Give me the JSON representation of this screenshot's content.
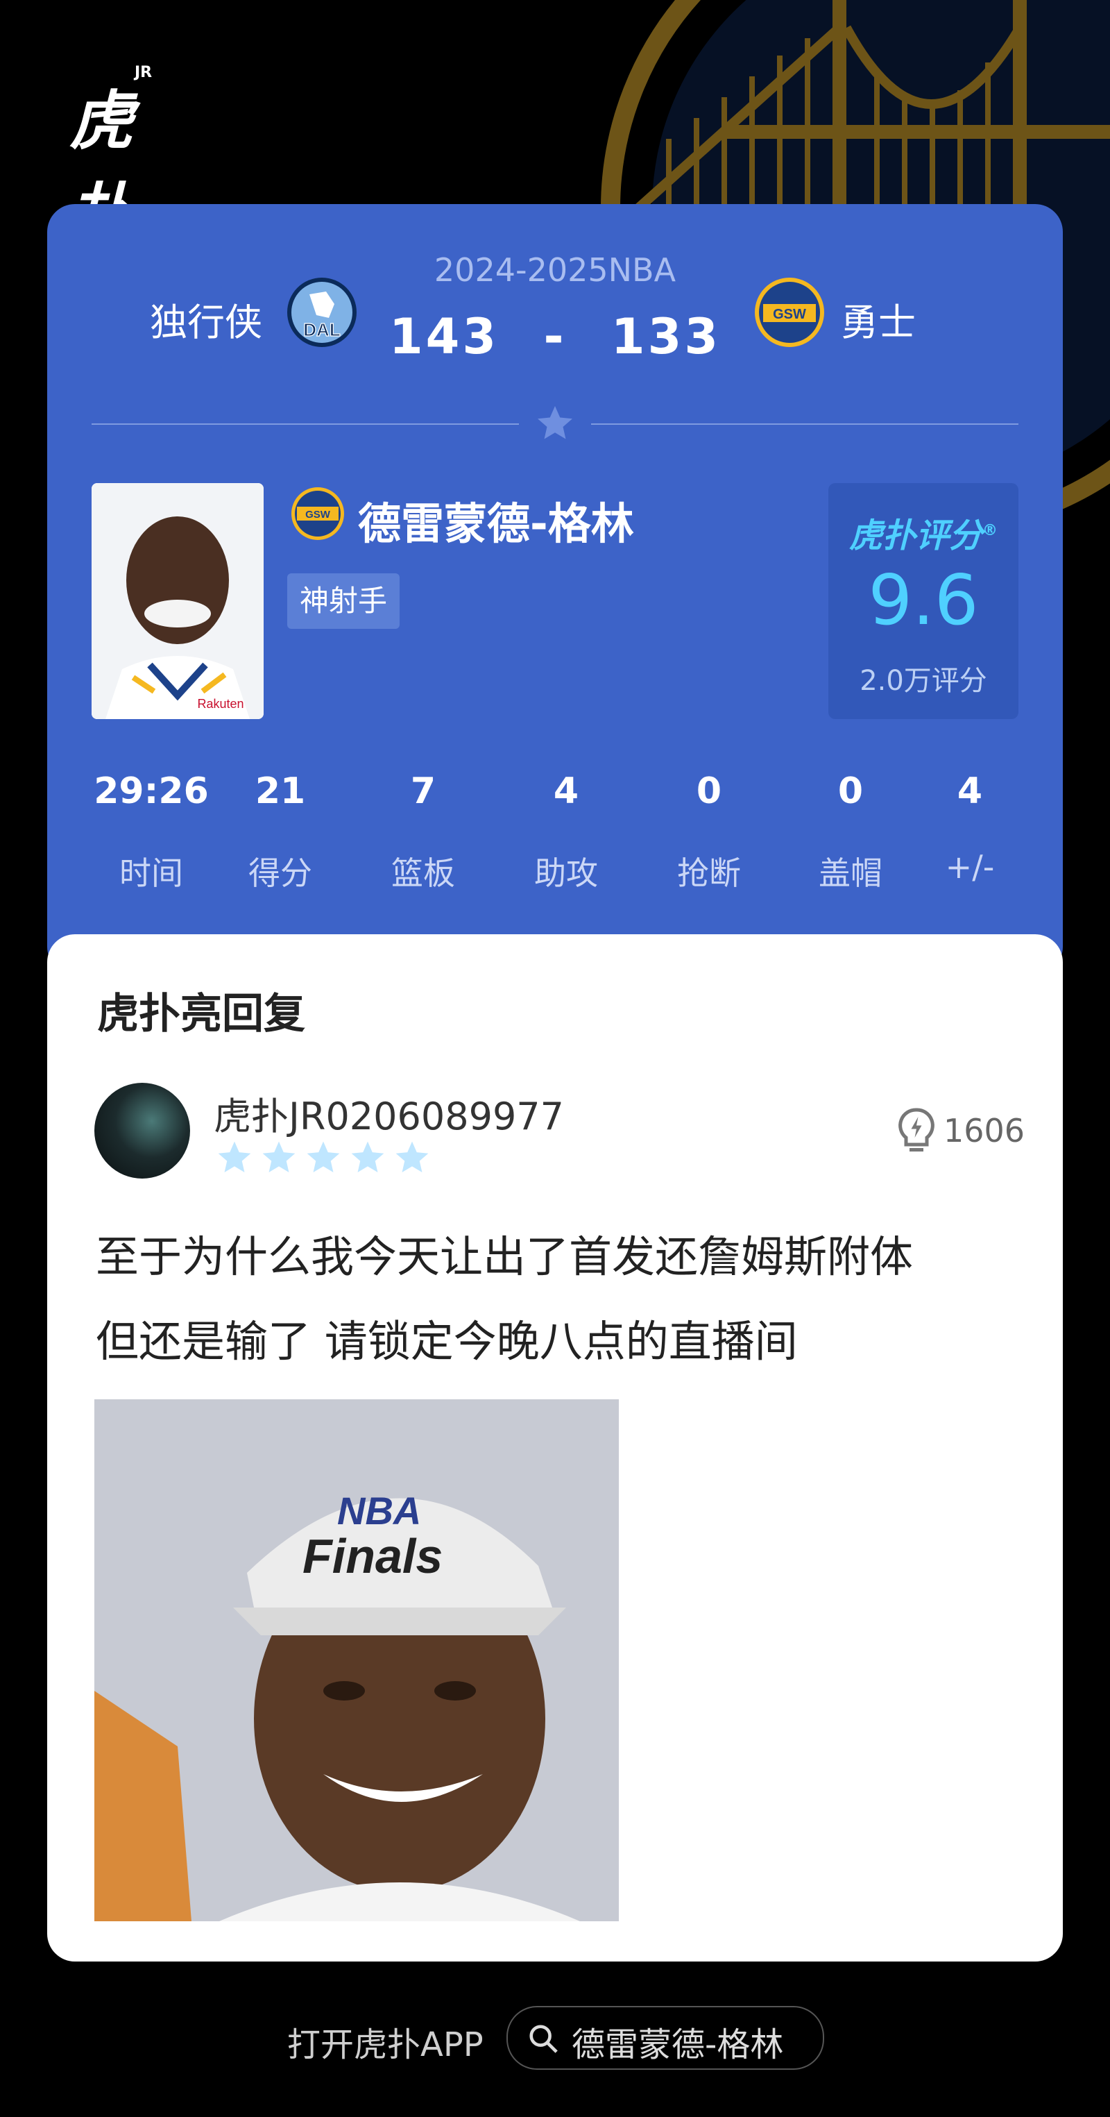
{
  "app": {
    "logo_text": "虎扑",
    "logo_sup": "JR"
  },
  "match": {
    "season": "2024-2025NBA",
    "home_team": "独行侠",
    "home_badge": "DAL",
    "away_team": "勇士",
    "away_badge": "GSW",
    "home_score": "143",
    "separator": "-",
    "away_score": "133"
  },
  "player": {
    "name": "德雷蒙德-格林",
    "team_badge": "GSW",
    "tag": "神射手",
    "jersey_sponsor": "Rakuten"
  },
  "rating": {
    "logo": "虎扑评分",
    "logo_mark": "®",
    "value": "9.6",
    "count": "2.0万评分"
  },
  "stats": [
    {
      "value": "29:26",
      "label": "时间"
    },
    {
      "value": "21",
      "label": "得分"
    },
    {
      "value": "7",
      "label": "篮板"
    },
    {
      "value": "4",
      "label": "助攻"
    },
    {
      "value": "0",
      "label": "抢断"
    },
    {
      "value": "0",
      "label": "盖帽"
    },
    {
      "value": "4",
      "label": "+/-"
    }
  ],
  "reply": {
    "section_title": "虎扑亮回复",
    "username": "虎扑JR0206089977",
    "star_rating": 5,
    "likes": "1606",
    "comment_line1": "至于为什么我今天让出了首发还詹姆斯附体",
    "comment_line2": "但还是输了 请锁定今晚八点的直播间",
    "meme_cap_text_top": "NBA",
    "meme_cap_text_bottom": "Finals"
  },
  "footer": {
    "open_app": "打开虎扑APP",
    "search_query": "德雷蒙德-格林"
  },
  "colors": {
    "card_blue": "#3d63c8",
    "rating_cyan": "#4fd0ff",
    "star_inactive": "#bfe6ff"
  }
}
